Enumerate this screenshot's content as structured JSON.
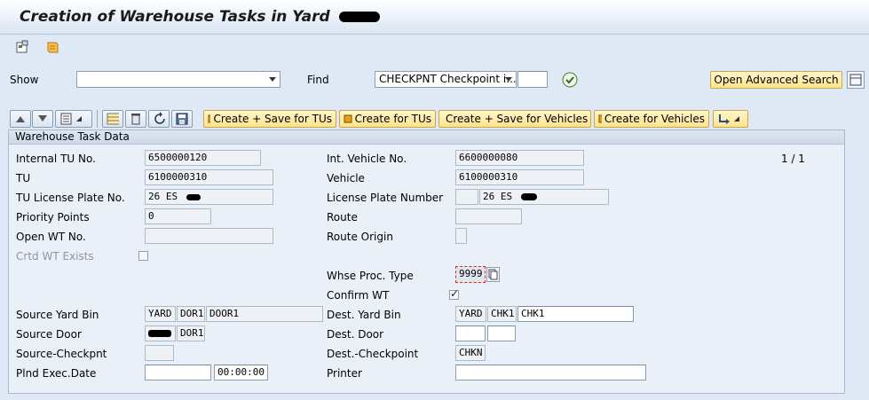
{
  "window": {
    "title": "Creation of Warehouse Tasks in Yard"
  },
  "toolbar1": {
    "icons": [
      "variant-icon",
      "document-icon"
    ]
  },
  "search": {
    "show_label": "Show",
    "show_value": "",
    "find_label": "Find",
    "find_value": "CHECKPNT Checkpoint i...",
    "find_extra": "",
    "advanced_label": "Open Advanced Search"
  },
  "actions": {
    "create_save_tus": "Create + Save for TUs",
    "create_tus": "Create for TUs",
    "create_save_vehicles": "Create + Save for Vehicles",
    "create_vehicles": "Create for Vehicles"
  },
  "group": {
    "title": "Warehouse Task Data",
    "pager": "1 / 1"
  },
  "left": {
    "internal_tu_label": "Internal TU No.",
    "internal_tu_value": "6500000120",
    "tu_label": "TU",
    "tu_value": "6100000310",
    "tu_plate_label": "TU License Plate No.",
    "tu_plate_value": "26 ES",
    "priority_label": "Priority Points",
    "priority_value": "0",
    "open_wt_label": "Open WT No.",
    "open_wt_value": "",
    "crtd_wt_label": "Crtd WT Exists",
    "source_bin_label": "Source Yard Bin",
    "source_bin_1": "YARD",
    "source_bin_2": "DOR1",
    "source_bin_3": "DOOR1",
    "source_door_label": "Source Door",
    "source_door_2": "DOR1",
    "source_checkpnt_label": "Source-Checkpnt",
    "source_checkpnt_value": "",
    "plnd_exec_label": "Plnd Exec.Date",
    "plnd_exec_date": "",
    "plnd_exec_time": "00:00:00"
  },
  "right": {
    "int_vehicle_label": "Int. Vehicle No.",
    "int_vehicle_value": "6600000080",
    "vehicle_label": "Vehicle",
    "vehicle_value": "6100000310",
    "plate_label": "License Plate Number",
    "plate_prefix": "",
    "plate_value": "26 ES",
    "route_label": "Route",
    "route_value": "",
    "route_origin_label": "Route Origin",
    "route_origin_value": "",
    "whse_proc_label": "Whse Proc. Type",
    "whse_proc_value": "9999",
    "confirm_wt_label": "Confirm WT",
    "dest_bin_label": "Dest. Yard Bin",
    "dest_bin_1": "YARD",
    "dest_bin_2": "CHK1",
    "dest_bin_3": "CHK1",
    "dest_door_label": "Dest. Door",
    "dest_door_1": "",
    "dest_door_2": "",
    "dest_checkpoint_label": "Dest.-Checkpoint",
    "dest_checkpoint_value": "CHKN",
    "printer_label": "Printer",
    "printer_value": ""
  }
}
